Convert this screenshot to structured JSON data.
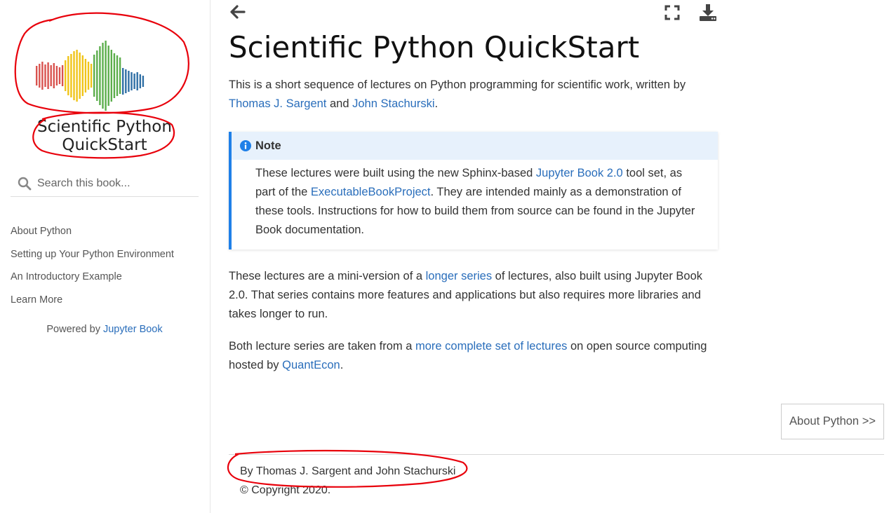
{
  "sidebar": {
    "site_title_line1": "Scientific Python",
    "site_title_line2": "QuickStart",
    "search": {
      "placeholder": "Search this book..."
    },
    "nav_items": [
      {
        "label": "About Python"
      },
      {
        "label": "Setting up Your Python Environment"
      },
      {
        "label": "An Introductory Example"
      },
      {
        "label": "Learn More"
      }
    ],
    "powered_by": {
      "prefix": "Powered by ",
      "link": "Jupyter Book"
    }
  },
  "toolbar": {
    "back_icon": "arrow-left-icon",
    "fullscreen_icon": "fullscreen-icon",
    "download_icon": "download-icon"
  },
  "main": {
    "title": "Scientific Python QuickStart",
    "intro": {
      "text1": "This is a short sequence of lectures on Python programming for scientific work, written by ",
      "link1": "Thomas J. Sargent",
      "text2": " and ",
      "link2": "John Stachurski",
      "text3": "."
    },
    "note": {
      "title": "Note",
      "text1": "These lectures were built using the new Sphinx-based ",
      "link1": "Jupyter Book 2.0",
      "text2": " tool set, as part of the ",
      "link2": "ExecutableBookProject",
      "text3": ". They are intended mainly as a demonstration of these tools. Instructions for how to build them from source can be found in the Jupyter Book documentation."
    },
    "series": {
      "text1": "These lectures are a mini-version of a ",
      "link1": "longer series",
      "text2": " of lectures, also built using Jupyter Book 2.0. That series contains more features and applications but also requires more libraries and takes longer to run."
    },
    "both": {
      "text1": "Both lecture series are taken from a ",
      "link1": "more complete set of lectures",
      "text2": " on open source computing hosted by ",
      "link2": "QuantEcon",
      "text3": "."
    }
  },
  "next_button": {
    "label": "About Python >>"
  },
  "footer": {
    "authors": "By Thomas J. Sargent and John Stachurski",
    "copyright": "© Copyright 2020."
  },
  "colors": {
    "link": "#2a6ebb",
    "note_border": "#1f80e8",
    "note_title_bg": "#e7f1fc",
    "annotation_red": "#e8000b",
    "logo_red": "#d9534f",
    "logo_yellow": "#f0c419",
    "logo_green": "#5cae4c",
    "logo_blue": "#2f6fa5"
  }
}
